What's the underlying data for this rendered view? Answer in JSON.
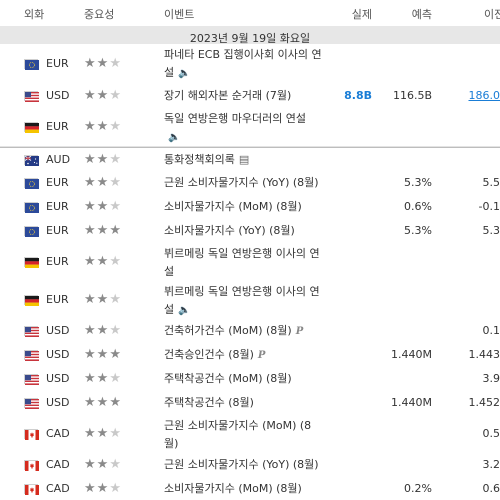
{
  "header": {
    "currency": "외화",
    "importance": "중요성",
    "event": "이벤트",
    "actual": "실제",
    "forecast": "예측",
    "previous": "이전"
  },
  "date_label": "2023년 9월 19일 화요일",
  "rows": [
    {
      "flag": "eu",
      "cur": "EUR",
      "stars": 2,
      "event": "파네타 ECB 집행이사회 이사의 연설",
      "icon": "sound",
      "actual": "",
      "forecast": "",
      "previous": ""
    },
    {
      "flag": "us",
      "cur": "USD",
      "stars": 2,
      "event": "장기 해외자본 순거래 (7월)",
      "icon": "",
      "actual": "8.8B",
      "forecast": "116.5B",
      "previous": "186.0"
    },
    {
      "flag": "de",
      "cur": "EUR",
      "stars": 2,
      "event": "독일 연방은행 마우더러의 연설",
      "icon": "sound",
      "actual": "",
      "forecast": "",
      "previous": ""
    },
    {
      "flag": "au",
      "cur": "AUD",
      "stars": 2,
      "event": "통화정책회의록",
      "icon": "doc",
      "actual": "",
      "forecast": "",
      "previous": ""
    },
    {
      "flag": "eu",
      "cur": "EUR",
      "stars": 2,
      "event": "근원 소비자물가지수 (YoY) (8월)",
      "icon": "",
      "actual": "",
      "forecast": "5.3%",
      "previous": "5.5"
    },
    {
      "flag": "eu",
      "cur": "EUR",
      "stars": 2,
      "event": "소비자물가지수 (MoM) (8월)",
      "icon": "",
      "actual": "",
      "forecast": "0.6%",
      "previous": "-0.1"
    },
    {
      "flag": "eu",
      "cur": "EUR",
      "stars": 3,
      "event": "소비자물가지수 (YoY) (8월)",
      "icon": "",
      "actual": "",
      "forecast": "5.3%",
      "previous": "5.3"
    },
    {
      "flag": "de",
      "cur": "EUR",
      "stars": 2,
      "event": "뷔르메링 독일 연방은행 이사의 연설",
      "icon": "",
      "actual": "",
      "forecast": "",
      "previous": ""
    },
    {
      "flag": "de",
      "cur": "EUR",
      "stars": 2,
      "event": "뷔르메링 독일 연방은행 이사의 연설",
      "icon": "sound",
      "actual": "",
      "forecast": "",
      "previous": ""
    },
    {
      "flag": "us",
      "cur": "USD",
      "stars": 2,
      "event": "건축허가건수 (MoM) (8월)",
      "icon": "p",
      "actual": "",
      "forecast": "",
      "previous": "0.1"
    },
    {
      "flag": "us",
      "cur": "USD",
      "stars": 3,
      "event": "건축승인건수 (8월)",
      "icon": "p",
      "actual": "",
      "forecast": "1.440M",
      "previous": "1.443"
    },
    {
      "flag": "us",
      "cur": "USD",
      "stars": 2,
      "event": "주택착공건수 (MoM) (8월)",
      "icon": "",
      "actual": "",
      "forecast": "",
      "previous": "3.9"
    },
    {
      "flag": "us",
      "cur": "USD",
      "stars": 3,
      "event": "주택착공건수 (8월)",
      "icon": "",
      "actual": "",
      "forecast": "1.440M",
      "previous": "1.452"
    },
    {
      "flag": "ca",
      "cur": "CAD",
      "stars": 2,
      "event": "근원 소비자물가지수 (MoM) (8월)",
      "icon": "",
      "actual": "",
      "forecast": "",
      "previous": "0.5"
    },
    {
      "flag": "ca",
      "cur": "CAD",
      "stars": 2,
      "event": "근원 소비자물가지수 (YoY) (8월)",
      "icon": "",
      "actual": "",
      "forecast": "",
      "previous": "3.2"
    },
    {
      "flag": "ca",
      "cur": "CAD",
      "stars": 2,
      "event": "소비자물가지수 (MoM) (8월)",
      "icon": "",
      "actual": "",
      "forecast": "0.2%",
      "previous": "0.6"
    }
  ],
  "colors": {
    "positive": "#1a7dd6",
    "star_on": "#8a8a8a",
    "star_off": "#c9c9c9",
    "date_bg": "#e7e7e7"
  }
}
